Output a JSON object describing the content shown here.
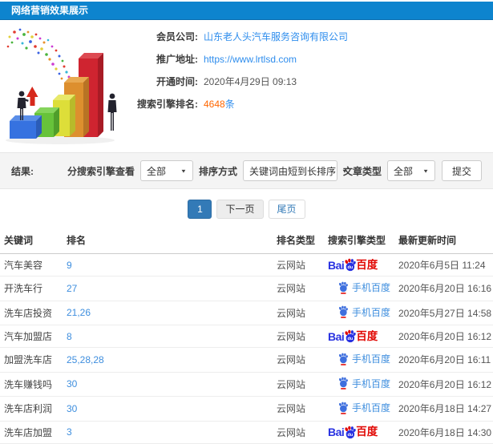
{
  "header": {
    "title": "网络营销效果展示"
  },
  "info": {
    "rows": [
      {
        "label": "会员公司:",
        "value": "山东老人头汽车服务咨询有限公司",
        "type": "link"
      },
      {
        "label": "推广地址:",
        "value": "https://www.lrtlsd.com",
        "type": "link"
      },
      {
        "label": "开通时间:",
        "value": "2020年4月29日 09:13",
        "type": "text"
      },
      {
        "label": "搜索引擎排名:",
        "value": "4648",
        "suffix": "条",
        "type": "highlight"
      }
    ]
  },
  "filters": {
    "result_label": "结果:",
    "engine_label": "分搜索引擎查看",
    "engine_value": "全部",
    "sort_label": "排序方式",
    "sort_value": "关键词由短到长排序",
    "article_label": "文章类型",
    "article_value": "全部",
    "submit_label": "提交"
  },
  "pagination": {
    "pages": [
      {
        "label": "1",
        "state": "active"
      },
      {
        "label": "下一页",
        "state": "next"
      },
      {
        "label": "尾页",
        "state": "last"
      }
    ]
  },
  "logos": {
    "baidu_en": "Bai",
    "baidu_du": "du",
    "baidu_cn": "百度",
    "mobile_baidu": "手机百度"
  },
  "table": {
    "headers": [
      "关键词",
      "排名",
      "排名类型",
      "搜索引擎类型",
      "最新更新时间"
    ],
    "rows": [
      {
        "keyword": "汽车美容",
        "rank": "9",
        "rank_type": "云网站",
        "engine": "baidu",
        "updated": "2020年6月5日 11:24"
      },
      {
        "keyword": "开洗车行",
        "rank": "27",
        "rank_type": "云网站",
        "engine": "mobile-baidu",
        "updated": "2020年6月20日 16:16"
      },
      {
        "keyword": "洗车店投资",
        "rank": "21,26",
        "rank_type": "云网站",
        "engine": "mobile-baidu",
        "updated": "2020年5月27日 14:58"
      },
      {
        "keyword": "汽车加盟店",
        "rank": "8",
        "rank_type": "云网站",
        "engine": "baidu",
        "updated": "2020年6月20日 16:12"
      },
      {
        "keyword": "加盟洗车店",
        "rank": "25,28,28",
        "rank_type": "云网站",
        "engine": "mobile-baidu",
        "updated": "2020年6月20日 16:11"
      },
      {
        "keyword": "洗车赚钱吗",
        "rank": "30",
        "rank_type": "云网站",
        "engine": "mobile-baidu",
        "updated": "2020年6月20日 16:12"
      },
      {
        "keyword": "洗车店利润",
        "rank": "30",
        "rank_type": "云网站",
        "engine": "mobile-baidu",
        "updated": "2020年6月18日 14:27"
      },
      {
        "keyword": "洗车店加盟",
        "rank": "3",
        "rank_type": "云网站",
        "engine": "baidu",
        "updated": "2020年6月18日 14:30"
      }
    ]
  },
  "colors": {
    "header_blue": "#0d84ce",
    "link_blue": "#2e8ded",
    "rank_blue": "#3e8ede",
    "highlight_orange": "#ff6600",
    "pagination_active": "#337ab7",
    "baidu_blue": "#2932e1",
    "baidu_red": "#e10602"
  }
}
